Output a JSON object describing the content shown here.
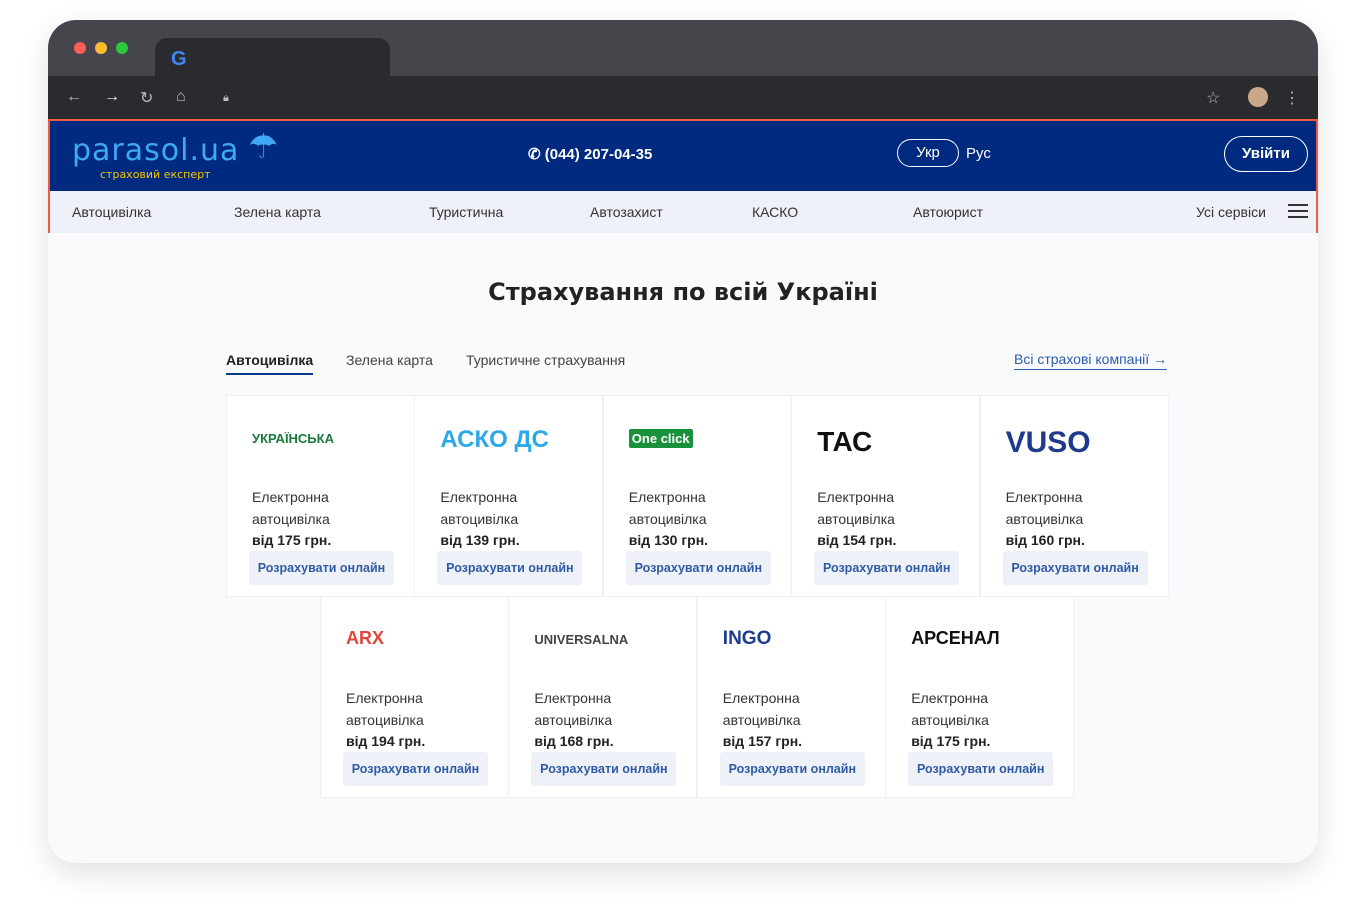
{
  "browser": {
    "lock_icon": "lock-icon"
  },
  "header": {
    "logo": "parasol.ua",
    "logo_tagline": "страховий експерт",
    "phone": "(044) 207-04-35",
    "lang_ukr": "Укр",
    "lang_rus": "Рус",
    "login": "Увійти",
    "colors": {
      "header_bg": "#002a7f",
      "accent": "#ef5a3c"
    }
  },
  "nav": [
    "Автоцивілка",
    "Зелена карта",
    "Туристична",
    "Автозахист",
    "КАСКО",
    "Автоюрист"
  ],
  "nav_all": "Усі сервіси",
  "title": "Страхування по всій Україні",
  "tabs": [
    "Автоцивілка",
    "Зелена карта",
    "Туристичне страхування"
  ],
  "all_companies": "Всі страхові компанії",
  "cards": [
    {
      "logo": "УКРАЇНСЬКА",
      "line1": "Електронна",
      "line2": "автоцивілка",
      "price": "від 175 грн.",
      "button": "Розрахувати онлайн"
    },
    {
      "logo": "АСКО ДС",
      "line1": "Електронна",
      "line2": "автоцивілка",
      "price": "від 139 грн.",
      "button": "Розрахувати онлайн"
    },
    {
      "logo": "One click",
      "line1": "Електронна",
      "line2": "автоцивілка",
      "price": "від 130 грн.",
      "button": "Розрахувати онлайн"
    },
    {
      "logo": "ТАС",
      "line1": "Електронна",
      "line2": "автоцивілка",
      "price": "від 154 грн.",
      "button": "Розрахувати онлайн"
    },
    {
      "logo": "VUSO",
      "line1": "Електронна",
      "line2": "автоцивілка",
      "price": "від 160 грн.",
      "button": "Розрахувати онлайн"
    },
    {
      "logo": "ARX",
      "line1": "Електронна",
      "line2": "автоцивілка",
      "price": "від 194 грн.",
      "button": "Розрахувати онлайн"
    },
    {
      "logo": "UNIVERSALNA",
      "line1": "Електронна",
      "line2": "автоцивілка",
      "price": "від 168 грн.",
      "button": "Розрахувати онлайн"
    },
    {
      "logo": "INGO",
      "line1": "Електронна",
      "line2": "автоцивілка",
      "price": "від 157 грн.",
      "button": "Розрахувати онлайн"
    },
    {
      "logo": "АРСЕНАЛ",
      "line1": "Електронна",
      "line2": "автоцивілка",
      "price": "від 175 грн.",
      "button": "Розрахувати онлайн"
    }
  ]
}
